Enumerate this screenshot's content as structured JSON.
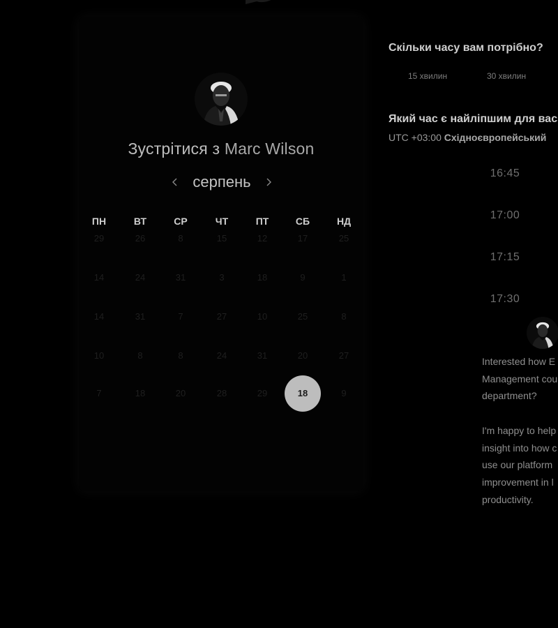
{
  "booking": {
    "meet_prefix": "Зустрітися з",
    "host_name": "Marc Wilson",
    "month": "серпень",
    "prev_icon": "chevron-left-icon",
    "next_icon": "chevron-right-icon"
  },
  "calendar": {
    "weekdays": [
      "ПН",
      "ВТ",
      "СР",
      "ЧТ",
      "ПТ",
      "СБ",
      "НД"
    ],
    "weeks": [
      [
        "29",
        "26",
        "8",
        "15",
        "12",
        "17",
        "25"
      ],
      [
        "14",
        "24",
        "31",
        "3",
        "18",
        "9",
        "1"
      ],
      [
        "14",
        "31",
        "7",
        "27",
        "10",
        "25",
        "8"
      ],
      [
        "10",
        "8",
        "8",
        "24",
        "31",
        "20",
        "27"
      ],
      [
        "7",
        "18",
        "20",
        "28",
        "29",
        "18",
        "9"
      ]
    ],
    "selected_day": "18"
  },
  "duration": {
    "question": "Скільки часу вам потрібно?",
    "options": [
      "15 хвилин",
      "30 хвилин"
    ]
  },
  "time": {
    "question": "Який час є найліпшим для вас",
    "timezone_offset": "UTC +03:00",
    "timezone_name": "Східноєвропейський",
    "slots": [
      "16:45",
      "17:00",
      "17:15",
      "17:30"
    ]
  },
  "message": {
    "lines_1": [
      "Interested how E",
      "Management cou",
      "department?"
    ],
    "lines_2": [
      "I'm happy to help",
      "insight into how c",
      "use our platform",
      "improvement in l",
      "productivity."
    ]
  },
  "colors": {
    "background": "#000000",
    "selected_day_bg": "#bdbdbd",
    "text_primary": "#cfcfcf",
    "text_muted": "#7d7d7d"
  }
}
